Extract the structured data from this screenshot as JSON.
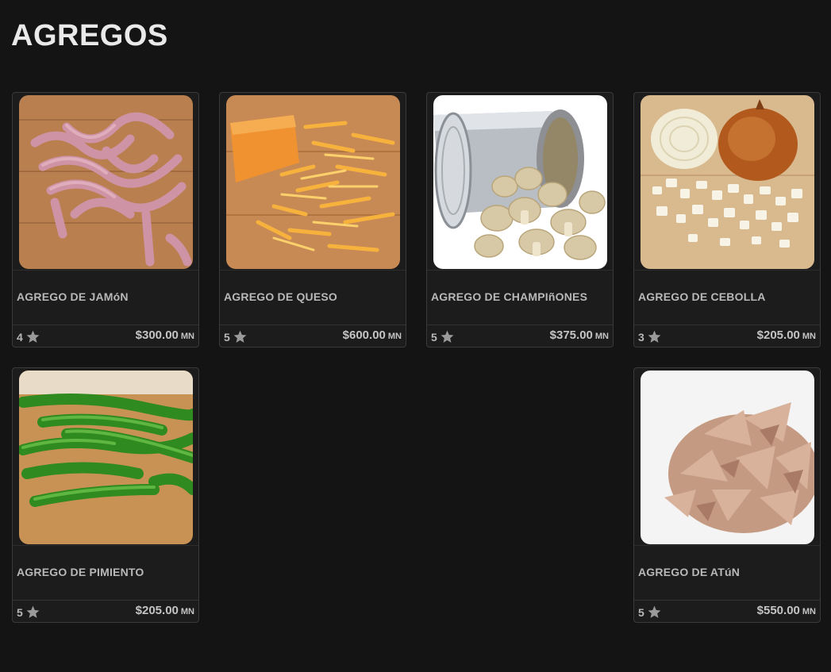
{
  "page": {
    "title": "AGREGOS"
  },
  "colors": {
    "background": "#141414",
    "card": "#1c1c1c",
    "card_border": "#3a3a3a",
    "text": "#b8b8b8",
    "star": "#9a9a9a"
  },
  "products": [
    {
      "name": "AGREGO DE JAMóN",
      "rating": "4",
      "price": "$300.00",
      "currency": "MN",
      "image": "ham-strips"
    },
    {
      "name": "AGREGO DE QUESO",
      "rating": "5",
      "price": "$600.00",
      "currency": "MN",
      "image": "grated-cheese"
    },
    {
      "name": "AGREGO DE CHAMPIñONES",
      "rating": "5",
      "price": "$375.00",
      "currency": "MN",
      "image": "canned-mushrooms"
    },
    {
      "name": "AGREGO DE CEBOLLA",
      "rating": "3",
      "price": "$205.00",
      "currency": "MN",
      "image": "chopped-onion"
    },
    {
      "name": "AGREGO DE PIMIENTO",
      "rating": "5",
      "price": "$205.00",
      "currency": "MN",
      "image": "green-pepper-strips"
    },
    {
      "name": "AGREGO DE ATúN",
      "rating": "5",
      "price": "$550.00",
      "currency": "MN",
      "image": "flaked-tuna"
    }
  ]
}
